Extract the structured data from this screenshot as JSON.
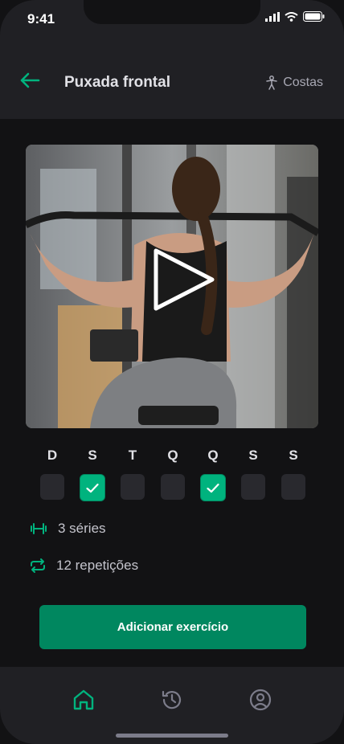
{
  "status_bar": {
    "time": "9:41"
  },
  "header": {
    "title": "Puxada frontal",
    "category": "Costas"
  },
  "video": {
    "subject": "woman doing lat pulldown in gym"
  },
  "days": [
    {
      "letter": "D",
      "checked": false
    },
    {
      "letter": "S",
      "checked": true
    },
    {
      "letter": "T",
      "checked": false
    },
    {
      "letter": "Q",
      "checked": false
    },
    {
      "letter": "Q",
      "checked": true
    },
    {
      "letter": "S",
      "checked": false
    },
    {
      "letter": "S",
      "checked": false
    }
  ],
  "info": {
    "sets": "3 séries",
    "reps": "12 repetições"
  },
  "action": {
    "button_label": "Adicionar exercício"
  },
  "colors": {
    "accent": "#00b37e",
    "button": "#00875f",
    "background": "#121214",
    "surface": "#202024"
  },
  "tabs": [
    {
      "icon": "home-icon",
      "active": true
    },
    {
      "icon": "history-icon",
      "active": false
    },
    {
      "icon": "profile-icon",
      "active": false
    }
  ]
}
